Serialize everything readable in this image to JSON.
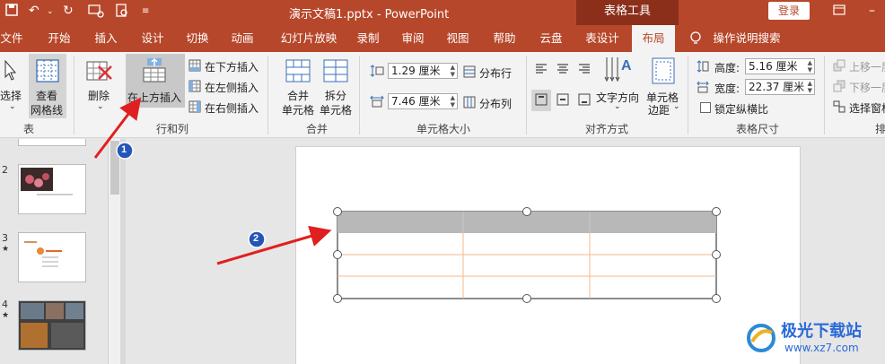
{
  "titlebar": {
    "doc_title": "演示文稿1.pptx  -  PowerPoint",
    "context_tab": "表格工具",
    "login": "登录"
  },
  "tabs": [
    "文件",
    "开始",
    "插入",
    "设计",
    "切换",
    "动画",
    "幻灯片放映",
    "录制",
    "审阅",
    "视图",
    "帮助",
    "云盘",
    "表设计",
    "布局"
  ],
  "active_tab": "布局",
  "tell_me": "操作说明搜索",
  "ribbon": {
    "table_group": {
      "label": "表",
      "select": "选择",
      "view_grid_line1": "查看",
      "view_grid_line2": "网格线"
    },
    "rows_cols": {
      "label": "行和列",
      "delete": "删除",
      "insert_above": "在上方插入",
      "insert_below": "在下方插入",
      "insert_left": "在左侧插入",
      "insert_right": "在右侧插入"
    },
    "merge": {
      "label": "合并",
      "merge_line1": "合并",
      "merge_line2": "单元格",
      "split_line1": "拆分",
      "split_line2": "单元格"
    },
    "cell_size": {
      "label": "单元格大小",
      "height_value": "1.29 厘米",
      "width_value": "7.46 厘米",
      "distribute_rows": "分布行",
      "distribute_cols": "分布列"
    },
    "alignment": {
      "label": "对齐方式",
      "text_direction": "文字方向",
      "margins_line1": "单元格",
      "margins_line2": "边距"
    },
    "table_size": {
      "label": "表格尺寸",
      "height_label": "高度:",
      "height_value": "5.16 厘米",
      "width_label": "宽度:",
      "width_value": "22.37 厘米",
      "lock_ratio": "锁定纵横比"
    },
    "arrange": {
      "label": "排",
      "bring_forward": "上移一层",
      "send_backward": "下移一层",
      "selection_pane": "选择窗格"
    }
  },
  "slides": [
    {
      "number": "2"
    },
    {
      "number": "3"
    },
    {
      "number": "4"
    }
  ],
  "annotations": {
    "badge1": "1",
    "badge2": "2"
  },
  "watermark": {
    "name": "极光下载站",
    "url": "www.xz7.com"
  }
}
